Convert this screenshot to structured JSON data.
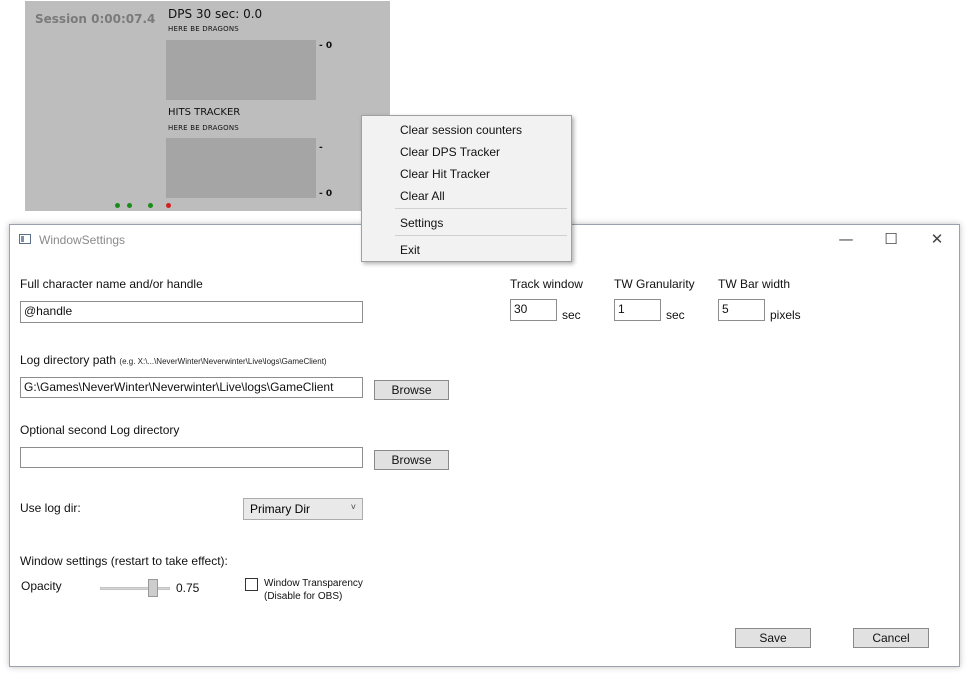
{
  "overlay": {
    "session": "Session 0:00:07.4",
    "dps_title": "DPS 30 sec: 0.0",
    "dps_subtitle": "HERE BE DRAGONS",
    "dps_axis_top": "- 0",
    "hits_title": "HITS TRACKER",
    "hits_subtitle": "HERE BE DRAGONS",
    "hits_axis_top": "-",
    "hits_axis_bottom": "- 0",
    "status_dots": [
      {
        "name": "status-dot-1",
        "color": "#1a8c1a"
      },
      {
        "name": "status-dot-2",
        "color": "#1a8c1a"
      },
      {
        "name": "status-dot-3",
        "color": "#1a8c1a"
      },
      {
        "name": "status-dot-4",
        "color": "#d21f1f"
      }
    ]
  },
  "context_menu": {
    "items": [
      "Clear session counters",
      "Clear DPS Tracker",
      "Clear Hit Tracker",
      "Clear All",
      "Settings",
      "Exit"
    ]
  },
  "window": {
    "title": "WindowSettings",
    "minimize": "—",
    "maximize": "☐",
    "close": "✕"
  },
  "settings": {
    "character_label": "Full character name and/or handle",
    "character_value": "@handle",
    "log_dir_label": "Log directory path",
    "log_dir_hint": "(e.g. X:\\...\\NeverWinter\\Neverwinter\\Live\\logs\\GameClient)",
    "log_dir_value": "G:\\Games\\NeverWinter\\Neverwinter\\Live\\logs\\GameClient",
    "browse_label": "Browse",
    "second_log_label": "Optional second Log directory",
    "second_log_value": "",
    "use_log_dir_label": "Use log dir:",
    "use_log_dir_value": "Primary Dir",
    "window_settings_label": "Window settings (restart to take effect):",
    "opacity_label": "Opacity",
    "opacity_value": "0.75",
    "transparency_label_1": "Window Transparency",
    "transparency_label_2": "(Disable for OBS)",
    "transparency_checked": false,
    "track_window_label": "Track window",
    "track_window_value": "30",
    "track_window_unit": "sec",
    "tw_granularity_label": "TW Granularity",
    "tw_granularity_value": "1",
    "tw_granularity_unit": "sec",
    "tw_bar_width_label": "TW Bar width",
    "tw_bar_width_value": "5",
    "tw_bar_width_unit": "pixels",
    "save_label": "Save",
    "cancel_label": "Cancel"
  }
}
